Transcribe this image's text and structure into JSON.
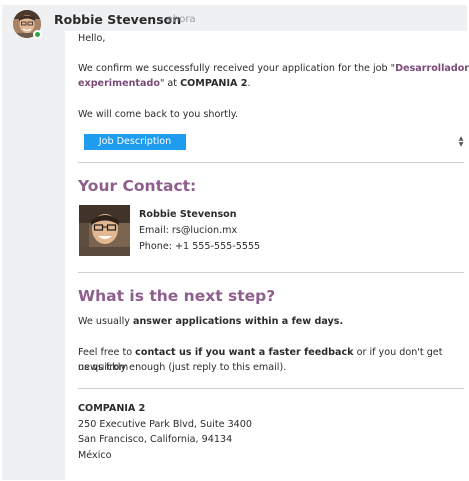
{
  "header": {
    "author": "Robbie Stevenson",
    "timestamp": "- ahora"
  },
  "message": {
    "greeting": "Hello,",
    "confirm_pre": "We confirm we successfully received your application for the job \"",
    "job_title_part1": "Desarrollador",
    "job_title_part2": "experimentado",
    "confirm_mid": "\" at ",
    "company": "COMPANIA 2",
    "confirm_end": ".",
    "come_back": "We will come back to you shortly.",
    "job_button": "Job Description"
  },
  "contact": {
    "title": "Your Contact:",
    "name": "Robbie Stevenson",
    "email": "Email: rs@lucion.mx",
    "phone": "Phone: +1 555-555-5555"
  },
  "next_step": {
    "title": "What is the next step?",
    "line1_pre": "We usually ",
    "line1_bold": "answer applications within a few days.",
    "line2_pre": "Feel free to ",
    "line2_bold": "contact us if you want a faster feedback",
    "line2_post": " or if you don't get news from",
    "line3": "us quickly enough (just reply to this email)."
  },
  "footer": {
    "company": "COMPANIA 2",
    "address1": "250 Executive Park Blvd, Suite 3400",
    "address2": "San Francisco, California, 94134",
    "country": "México"
  },
  "colors": {
    "accent": "#8e5e8c",
    "button": "#1e9cf0",
    "online": "#28a745"
  }
}
